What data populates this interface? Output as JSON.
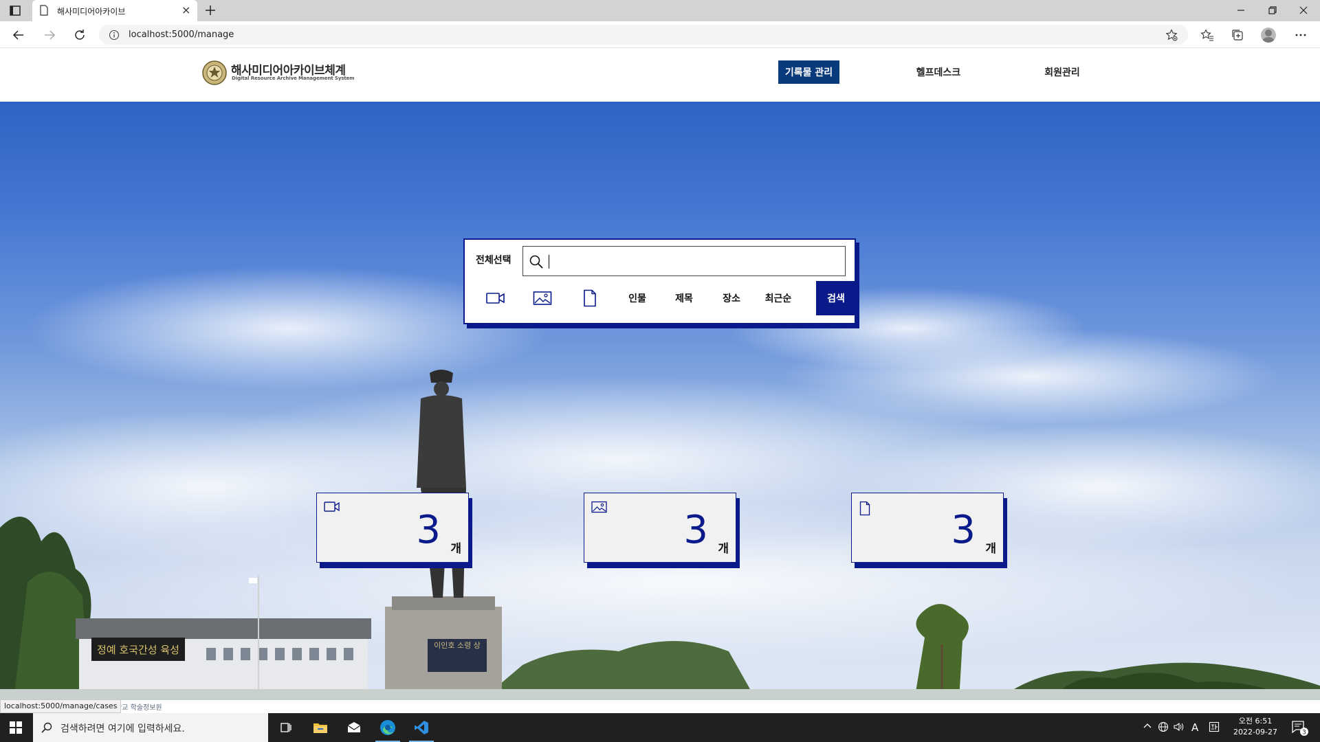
{
  "browser": {
    "tab_title": "해사미디어아카이브",
    "tab_close": "×",
    "new_tab": "+",
    "url": "localhost:5000/manage",
    "status_url": "localhost:5000/manage/cases"
  },
  "site": {
    "logo_title": "해사미디어아카이브체계",
    "logo_subtitle": "Digital Resource Archive Management System",
    "menu": [
      {
        "label": "기록물 관리",
        "active": true
      },
      {
        "label": "헬프데스크",
        "active": false
      },
      {
        "label": "회원관리",
        "active": false
      }
    ]
  },
  "search": {
    "select_all_label": "전체선택",
    "input_value": "",
    "filters": [
      {
        "icon": "video-icon",
        "label": ""
      },
      {
        "icon": "image-icon",
        "label": ""
      },
      {
        "icon": "document-icon",
        "label": ""
      },
      {
        "icon": "",
        "label": "인물"
      },
      {
        "icon": "",
        "label": "제목"
      },
      {
        "icon": "",
        "label": "장소"
      },
      {
        "icon": "",
        "label": "최근순"
      }
    ],
    "submit_label": "검색"
  },
  "counts": [
    {
      "type": "video",
      "icon": "video-icon",
      "value": "3",
      "unit": "개"
    },
    {
      "type": "image",
      "icon": "image-icon",
      "value": "3",
      "unit": "개"
    },
    {
      "type": "document",
      "icon": "document-icon",
      "value": "3",
      "unit": "개"
    }
  ],
  "hero": {
    "building_sign": "정예 호국간성 육성",
    "statue_plaque": "이인호 소령 상",
    "bg_caption": "학교 학술정보원"
  },
  "taskbar": {
    "search_placeholder": "검색하려면 여기에 입력하세요.",
    "clock_time": "오전 6:51",
    "clock_date": "2022-09-27",
    "notification_count": "3",
    "ime_label": "A"
  },
  "colors": {
    "accent_navy": "#0a1a8a",
    "menu_active_bg": "#083a7c",
    "sky_top": "#2f62c4"
  }
}
